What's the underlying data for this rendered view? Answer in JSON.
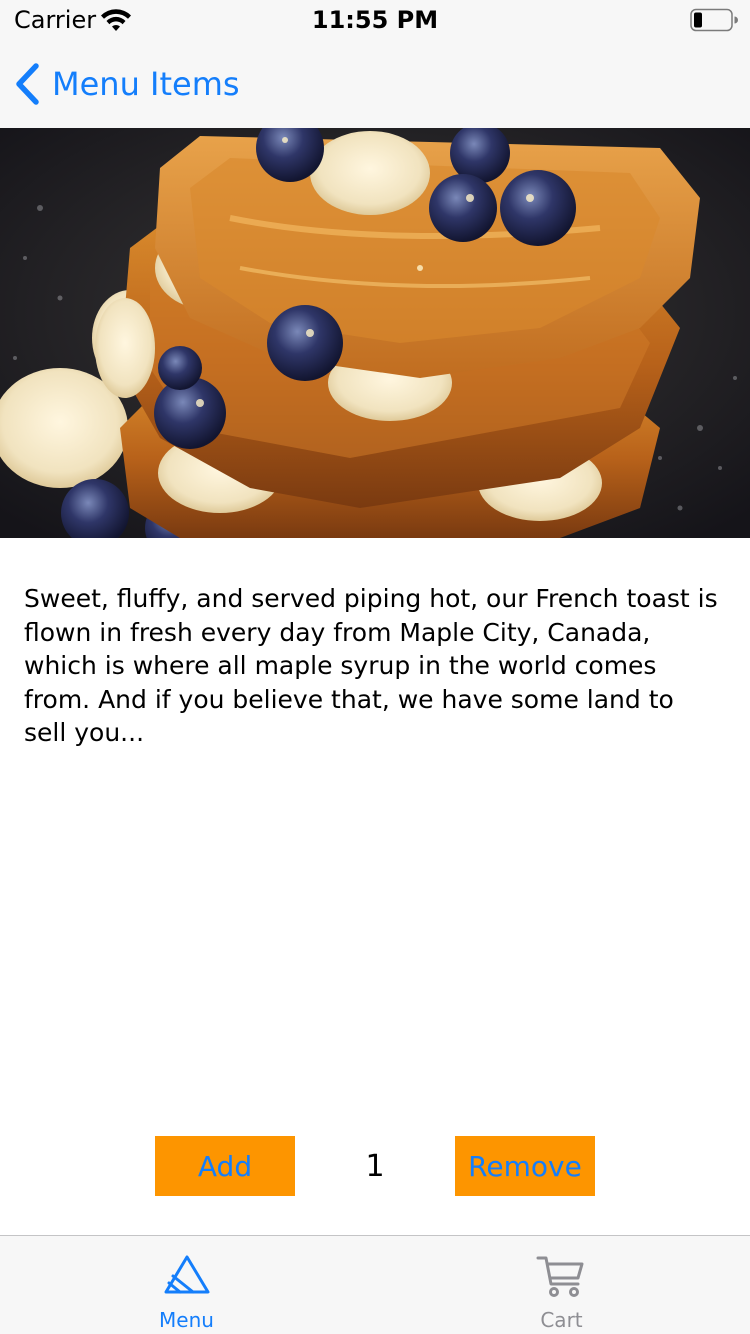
{
  "status_bar": {
    "carrier": "Carrier",
    "time": "11:55 PM",
    "icons": [
      "wifi-icon",
      "battery-icon"
    ]
  },
  "nav": {
    "back_label": "Menu Items",
    "back_icon": "chevron-left-icon",
    "tint_color": "#147efb"
  },
  "item": {
    "image_subject": "French toast with blueberries, banana slices and maple syrup",
    "description": "Sweet, fluffy, and served piping hot, our French toast is flown in fresh every day from Maple City, Canada, which is where all maple syrup in the world comes from. And if you believe that, we have some land to sell you..."
  },
  "controls": {
    "add_label": "Add",
    "quantity": "1",
    "remove_label": "Remove",
    "button_color": "#fd9500",
    "button_text_color": "#147efb"
  },
  "tab_bar": {
    "tabs": [
      {
        "label": "Menu",
        "icon": "menu-icon",
        "selected": true,
        "color": "#147efb"
      },
      {
        "label": "Cart",
        "icon": "cart-icon",
        "selected": false,
        "color": "#8e8e93"
      }
    ]
  }
}
